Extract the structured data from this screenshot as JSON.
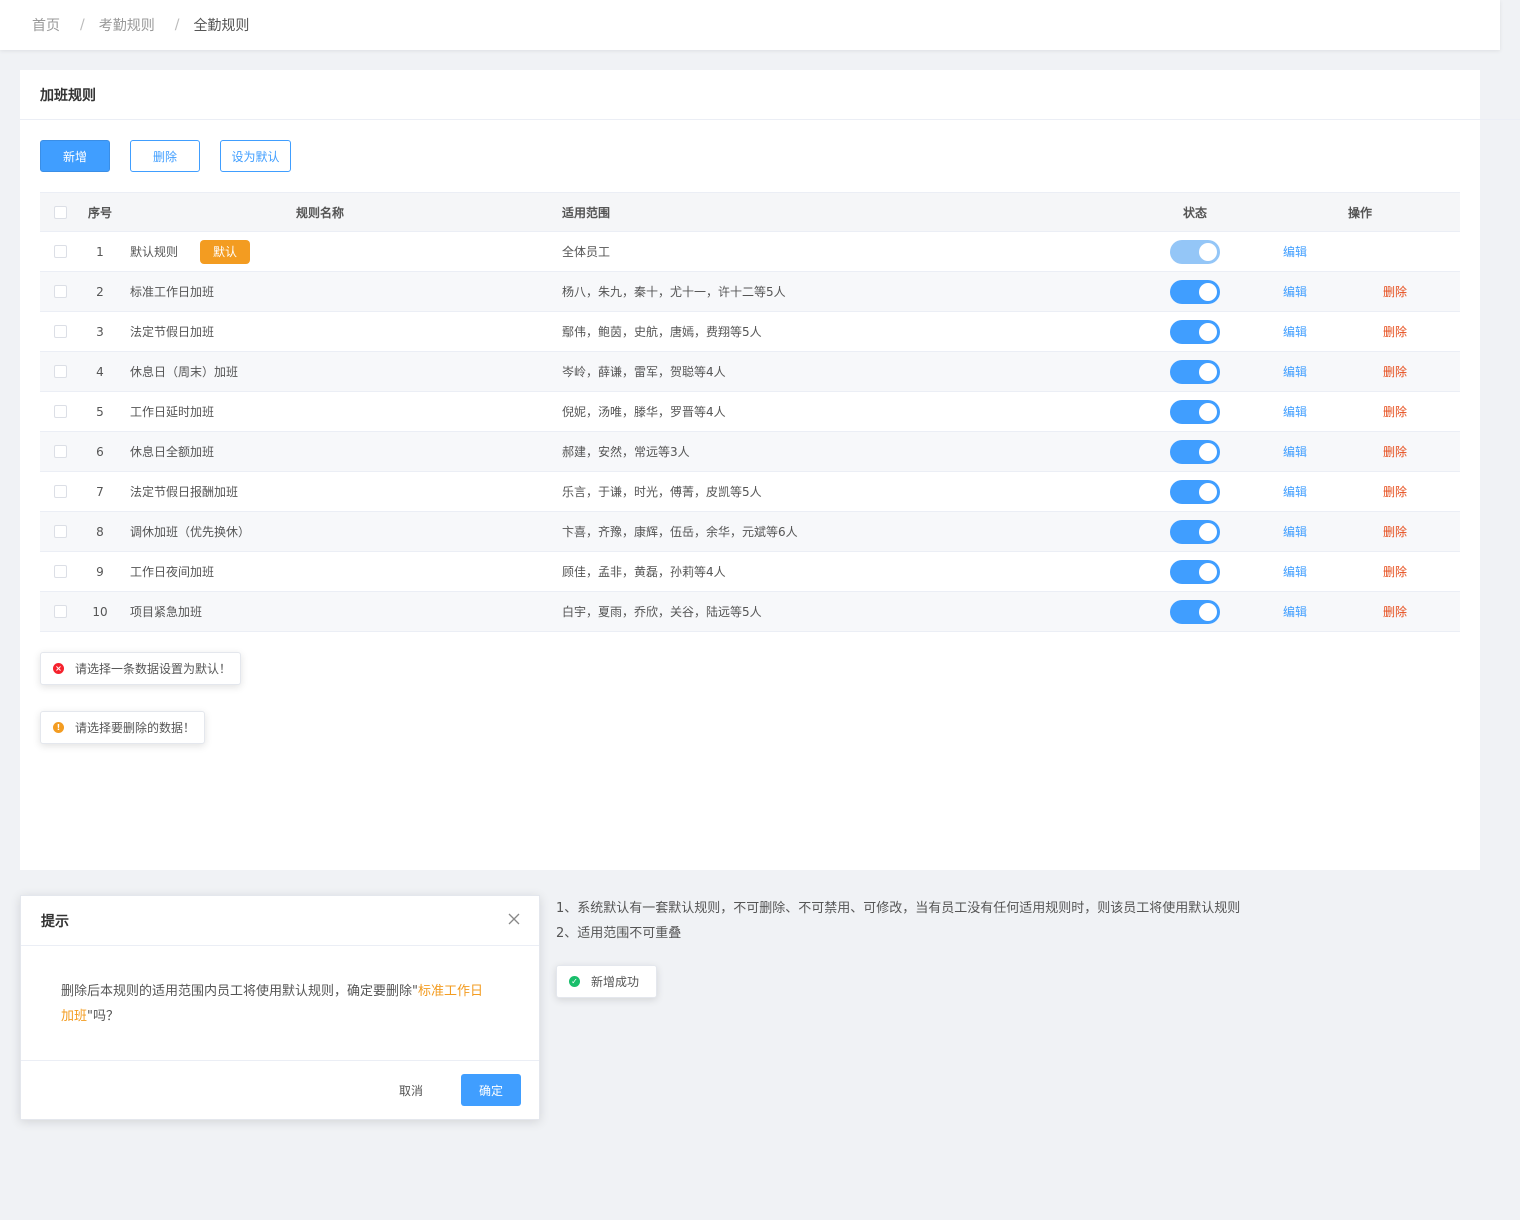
{
  "breadcrumb": {
    "home": "首页",
    "level2": "考勤规则",
    "current": "全勤规则",
    "separator": "/"
  },
  "card": {
    "title": "加班规则"
  },
  "toolbar": {
    "add_label": "新增",
    "delete_label": "删除",
    "set_default_label": "设为默认"
  },
  "table": {
    "headers": {
      "index": "序号",
      "name": "规则名称",
      "scope": "适用范围",
      "status": "状态",
      "ops": "操作"
    },
    "default_tag": "默认",
    "edit_label": "编辑",
    "delete_label": "删除",
    "rows": [
      {
        "index": "1",
        "name": "默认规则",
        "scope": "全体员工",
        "is_default": true,
        "enabled": true
      },
      {
        "index": "2",
        "name": "标准工作日加班",
        "scope": "杨八，朱九，秦十，尤十一，许十二等5人",
        "is_default": false,
        "enabled": true
      },
      {
        "index": "3",
        "name": "法定节假日加班",
        "scope": "鄢伟，鲍茵，史航，唐嫣，费翔等5人",
        "is_default": false,
        "enabled": true
      },
      {
        "index": "4",
        "name": "休息日（周末）加班",
        "scope": "岑岭，薛谦，雷军，贺聪等4人",
        "is_default": false,
        "enabled": true
      },
      {
        "index": "5",
        "name": "工作日延时加班",
        "scope": "倪妮，汤唯，滕华，罗晋等4人",
        "is_default": false,
        "enabled": true
      },
      {
        "index": "6",
        "name": "休息日全额加班",
        "scope": "郝建，安然，常远等3人",
        "is_default": false,
        "enabled": true
      },
      {
        "index": "7",
        "name": "法定节假日报酬加班",
        "scope": "乐言，于谦，时光，傅菁，皮凯等5人",
        "is_default": false,
        "enabled": true
      },
      {
        "index": "8",
        "name": "调休加班（优先换休）",
        "scope": "卞喜，齐豫，康辉，伍岳，余华，元斌等6人",
        "is_default": false,
        "enabled": true
      },
      {
        "index": "9",
        "name": "工作日夜间加班",
        "scope": "顾佳，孟非，黄磊，孙莉等4人",
        "is_default": false,
        "enabled": true
      },
      {
        "index": "10",
        "name": "项目紧急加班",
        "scope": "白宇，夏雨，乔欣，关谷，陆远等5人",
        "is_default": false,
        "enabled": true
      }
    ]
  },
  "messages": {
    "error_text": "请选择一条数据设置为默认！",
    "warning_text": "请选择要删除的数据！",
    "success_text": "新增成功"
  },
  "dialog": {
    "title": "提示",
    "body_prefix": "删除后本规则的适用范围内员工将使用默认规则，确定要删除\"",
    "body_highlight": "标准工作日加班",
    "body_suffix": "\"吗？",
    "cancel_label": "取消",
    "ok_label": "确定"
  },
  "notes": {
    "line1": "1、系统默认有一套默认规则，不可删除、不可禁用、可修改，当有员工没有任何适用规则时，则该员工将使用默认规则",
    "line2": "2、适用范围不可重叠"
  },
  "colors": {
    "primary": "#409eff",
    "danger": "#e64c1a",
    "warning": "#f39c21",
    "success": "#19be6b",
    "error": "#f5222d"
  }
}
